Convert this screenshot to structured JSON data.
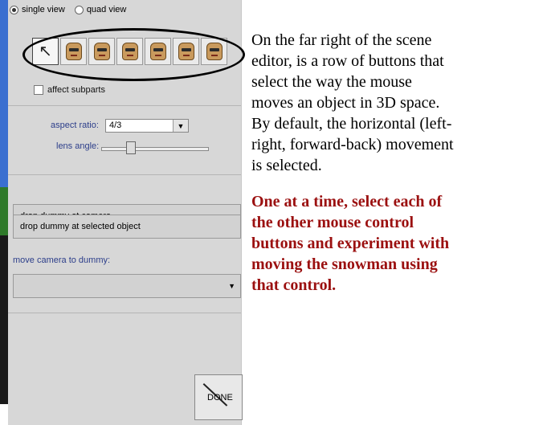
{
  "editor": {
    "view_options": {
      "single_label": "single view",
      "quad_label": "quad view",
      "selected": "single view"
    },
    "mouse_mode_buttons": [
      "pointer",
      "move-free",
      "move-up-down",
      "turn",
      "roll",
      "tumble",
      "resize"
    ],
    "mouse_mode_icons": [
      "pointer-arrow-icon",
      "snowman-face-icon",
      "snowman-face-icon",
      "snowman-face-icon",
      "snowman-face-icon",
      "snowman-face-icon",
      "snowman-face-icon"
    ],
    "affect_subparts_label": "affect subparts",
    "aspect_ratio": {
      "label": "aspect ratio:",
      "value": "4/3"
    },
    "lens_angle": {
      "label": "lens angle:"
    },
    "drop_dummy_camera_label": "drop dummy at camera",
    "drop_dummy_object_label": "drop dummy at selected object",
    "move_camera_label": "move camera to dummy:",
    "done_label": "DONE"
  },
  "instructions": {
    "paragraph1_lines": [
      "On the far right of the scene",
      "editor, is a row of buttons that",
      "select the way the mouse",
      "moves an object in 3D space.",
      "By default, the horizontal (left-",
      "right, forward-back) movement",
      "is selected."
    ],
    "paragraph2_lines": [
      "One at a time, select each of",
      "the other mouse control",
      "buttons and experiment with",
      "moving the snowman using",
      "that control."
    ]
  },
  "colors": {
    "label_blue": "#2c3e8a",
    "instruction_red": "#9b1010",
    "panel_gray": "#d7d7d7"
  }
}
